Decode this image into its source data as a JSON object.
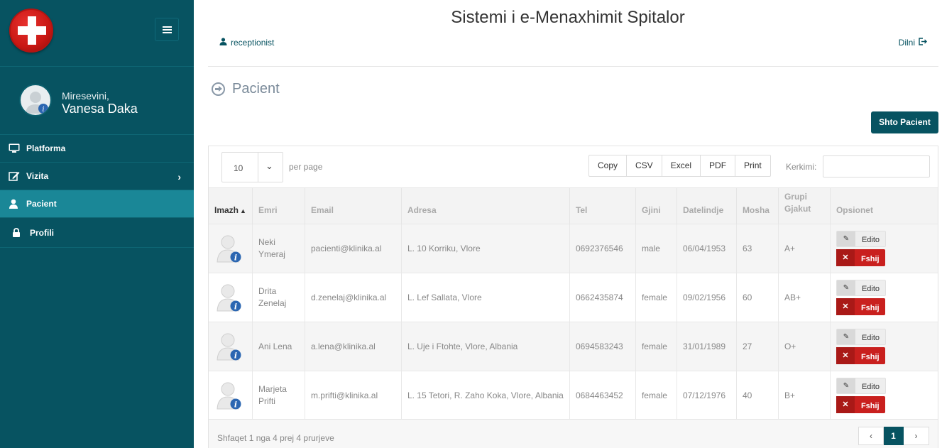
{
  "app": {
    "title": "Sistemi i e-Menaxhimit Spitalor"
  },
  "header": {
    "user": "receptionist",
    "logout": "Dilni"
  },
  "sidebar": {
    "welcome": "Miresevini,",
    "username": "Vanesa Daka",
    "items": [
      {
        "label": "Platforma",
        "icon": "monitor-icon"
      },
      {
        "label": "Vizita",
        "icon": "edit-icon"
      },
      {
        "label": "Pacient",
        "icon": "user-icon",
        "active": true
      },
      {
        "label": "Profili",
        "icon": "lock-icon"
      }
    ]
  },
  "page": {
    "heading": "Pacient",
    "add_button": "Shto Pacient"
  },
  "table_controls": {
    "per_page_value": "10",
    "per_page_label": "per page",
    "export_buttons": [
      "Copy",
      "CSV",
      "Excel",
      "PDF",
      "Print"
    ],
    "search_label": "Kerkimi:",
    "search_value": ""
  },
  "table": {
    "columns": [
      "Imazh",
      "Emri",
      "Email",
      "Adresa",
      "Tel",
      "Gjini",
      "Datelindje",
      "Mosha",
      "Grupi Gjakut",
      "Opsionet"
    ],
    "rows": [
      {
        "name": "Neki Ymeraj",
        "email": "pacienti@klinika.al",
        "address": "L. 10 Korriku, Vlore",
        "tel": "0692376546",
        "gender": "male",
        "dob": "06/04/1953",
        "age": "63",
        "blood": "A+"
      },
      {
        "name": "Drita Zenelaj",
        "email": "d.zenelaj@klinika.al",
        "address": "L. Lef Sallata, Vlore",
        "tel": "0662435874",
        "gender": "female",
        "dob": "09/02/1956",
        "age": "60",
        "blood": "AB+"
      },
      {
        "name": "Ani Lena",
        "email": "a.lena@klinika.al",
        "address": "L. Uje i Ftohte, Vlore, Albania",
        "tel": "0694583243",
        "gender": "female",
        "dob": "31/01/1989",
        "age": "27",
        "blood": "O+"
      },
      {
        "name": "Marjeta Prifti",
        "email": "m.prifti@klinika.al",
        "address": "L. 15 Tetori, R. Zaho Koka, Vlore, Albania",
        "tel": "0684463452",
        "gender": "female",
        "dob": "07/12/1976",
        "age": "40",
        "blood": "B+"
      }
    ],
    "edit_label": "Edito",
    "delete_label": "Fshij"
  },
  "footer": {
    "info": "Shfaqet 1 nga 4 prej 4 prurjeve",
    "pager_prev": "‹",
    "pager_current": "1",
    "pager_next": "›"
  },
  "colors": {
    "sidebar": "#075361",
    "active": "#1a8797",
    "danger": "#c9201e"
  }
}
